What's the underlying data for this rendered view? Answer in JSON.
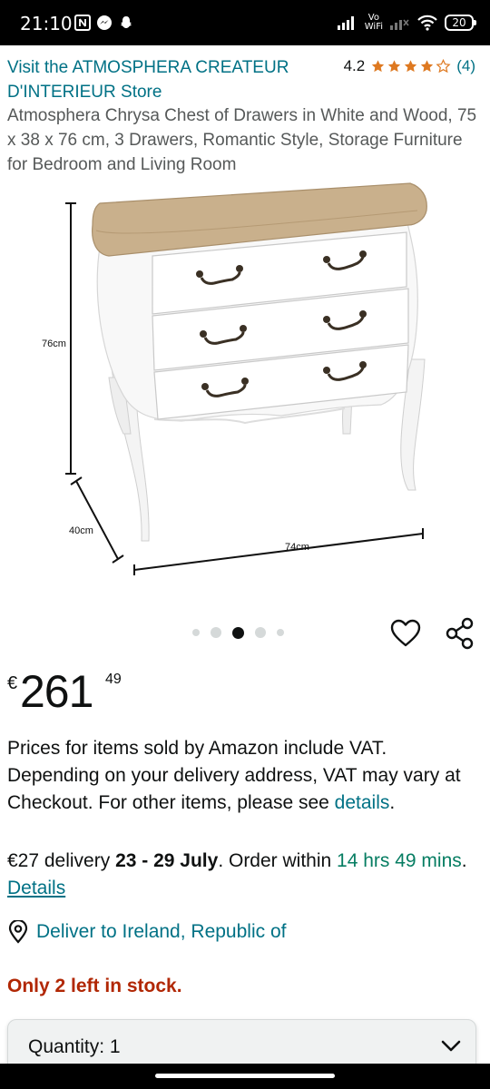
{
  "status_bar": {
    "time": "21:10",
    "vowifi_top": "Vo",
    "vowifi_bottom": "WiFi",
    "battery": "20"
  },
  "store": {
    "link_text": "Visit the ATMOSPHERA CREATEUR D'INTERIEUR Store",
    "rating_value": "4.2",
    "rating_fraction": 0.84,
    "rating_count": "(4)"
  },
  "product": {
    "title": "Atmosphera Chrysa Chest of Drawers in White and Wood, 75 x 38 x 76 cm, 3 Drawers, Romantic Style, Storage Furniture for Bedroom and Living Room",
    "image": {
      "height_label": "76cm",
      "depth_label": "40cm",
      "width_label": "74cm"
    },
    "carousel": {
      "total": 5,
      "active_index": 2
    }
  },
  "price": {
    "symbol": "€",
    "whole": "261",
    "fraction": "49"
  },
  "vat": {
    "text": "Prices for items sold by Amazon include VAT. Depending on your delivery address, VAT may vary at Checkout. For other items, please see ",
    "link": "details",
    "suffix": "."
  },
  "delivery": {
    "cost": "€27 delivery ",
    "dates": "23 - 29 July",
    "order_within": ". Order within ",
    "countdown": "14 hrs 49 mins",
    "period": ". ",
    "details_link": "Details"
  },
  "deliver_to": {
    "text": "Deliver to Ireland, Republic of",
    "icon": "location-pin-icon"
  },
  "stock": "Only 2 left in stock.",
  "quantity": {
    "label": "Quantity: 1"
  },
  "colors": {
    "link": "#007185",
    "stock": "#b12704",
    "star": "#de7921",
    "countdown": "#067d62"
  }
}
